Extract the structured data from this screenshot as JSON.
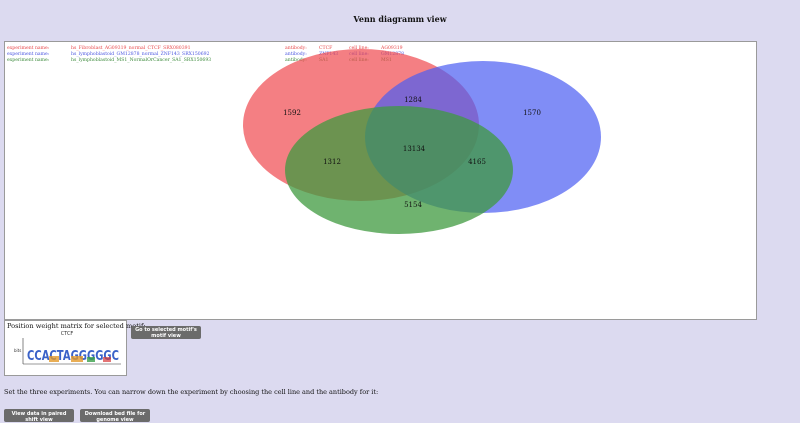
{
  "header": {
    "title": "Venn diagramm view"
  },
  "experiments": [
    {
      "label": "experiment name:",
      "name": "hs_Fibroblast_AG09319_normal_CTCF_SRX080391",
      "antibody_label": "antibody:",
      "antibody": "CTCF",
      "cell_line_label": "cell line:",
      "cell_line": "AG09319",
      "color": "#e8474a"
    },
    {
      "label": "experiment name:",
      "name": "hs_lymphoblastoid_GM12878_normal_ZNF143_SRX150692",
      "antibody_label": "antibody:",
      "antibody": "ZNF143",
      "cell_line_label": "cell line:",
      "cell_line": "GM12878",
      "color": "#4a55e0"
    },
    {
      "label": "experiment name:",
      "name": "hs_lymphoblastoid_MS1_NormalOrCancer_SA1_SRX150693",
      "antibody_label": "antibody:",
      "antibody": "SA1",
      "cell_line_label": "cell line:",
      "cell_line": "MS1",
      "color": "#3c8a3c"
    }
  ],
  "venn": {
    "colors": {
      "red": "#f0484e",
      "blue": "#4a5cf2",
      "green": "#3f9a3f"
    },
    "regions": {
      "red_only": "1592",
      "red_blue": "1284",
      "blue_only": "1570",
      "red_green": "1312",
      "all_three": "13134",
      "blue_green": "4165",
      "green_only": "5154"
    }
  },
  "motif": {
    "title": "Position weight matrix for selected motif:",
    "logo_name": "CTCF",
    "sequence_glyphs": "CCACTAGGGGGC",
    "button_label": "Go to selected motif's motif view"
  },
  "instructions": "Set the three experiments. You can narrow down the experiment by choosing the cell line and the antibody for it:",
  "buttons": {
    "paired_label": "View data in paired shift view",
    "bed_label": "Download bed file for genome view"
  }
}
